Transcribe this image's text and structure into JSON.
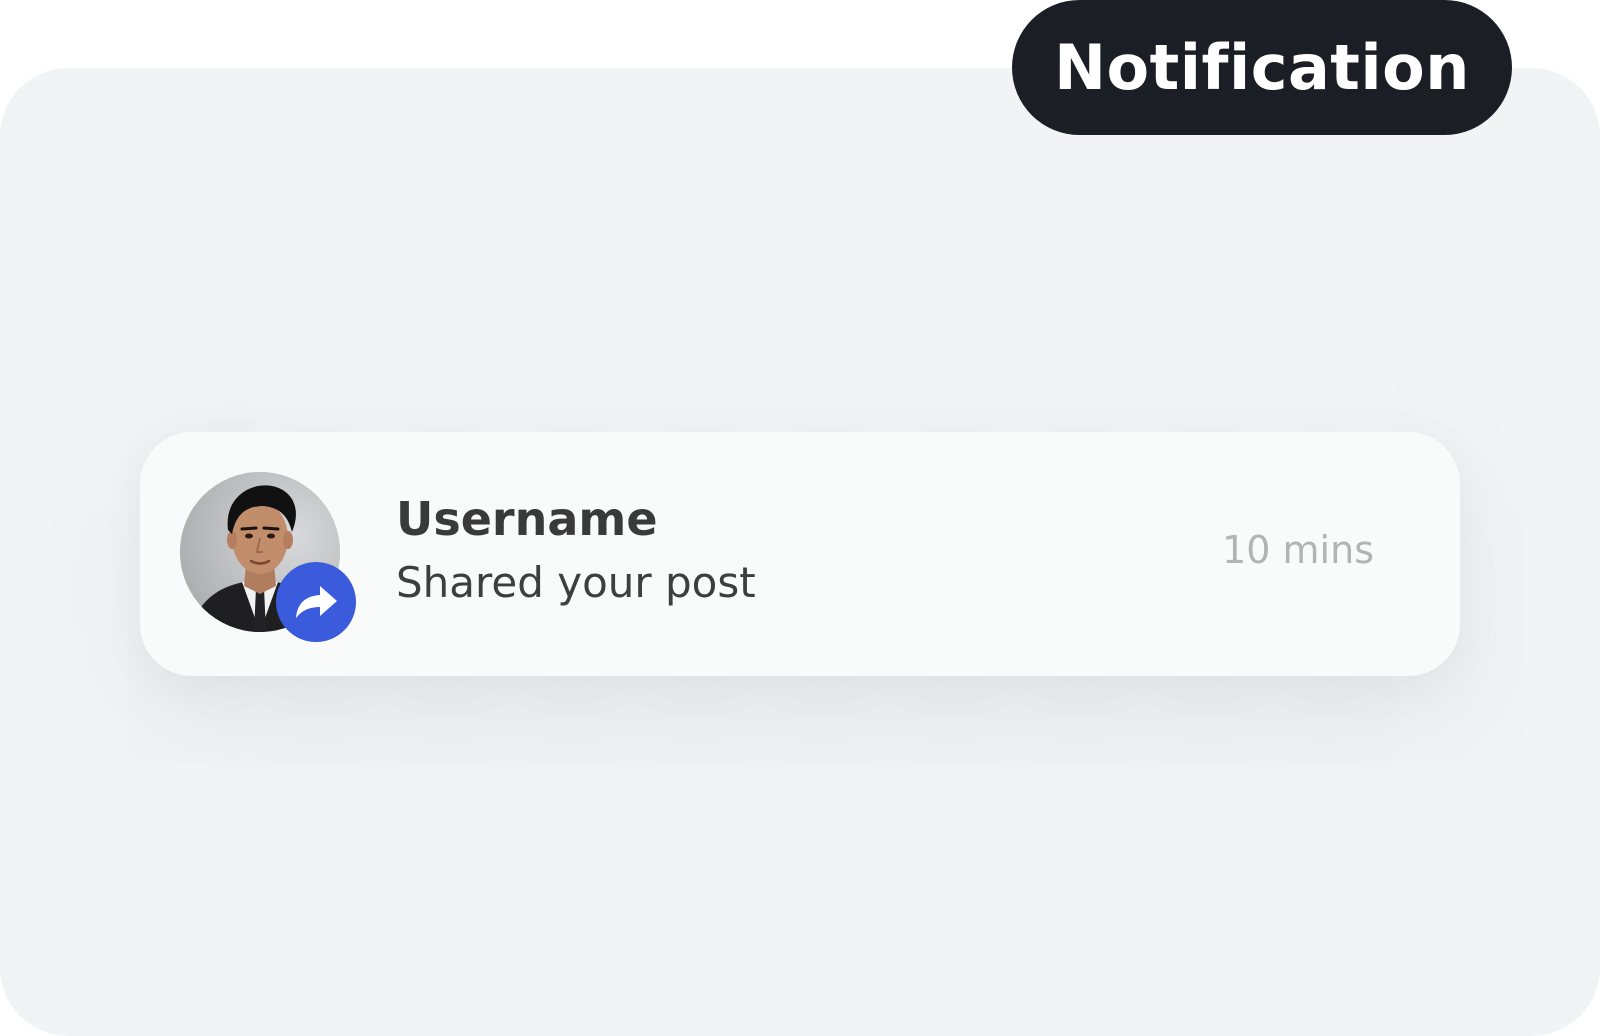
{
  "header": {
    "title": "Notification"
  },
  "notification": {
    "username": "Username",
    "message": "Shared your post",
    "time": "10 mins",
    "avatar_icon": "user-avatar-photo",
    "badge_icon": "share-arrow-icon"
  },
  "colors": {
    "pill_background": "#1c1e26",
    "badge_background": "#3a5bdb",
    "panel_background": "#f2f3f5",
    "card_background": "#f9fafa"
  }
}
